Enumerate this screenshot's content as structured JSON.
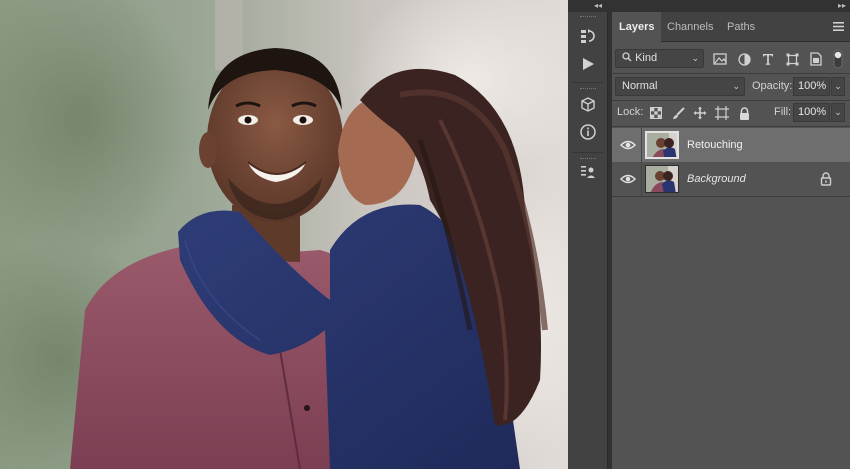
{
  "panel": {
    "tabs": [
      {
        "label": "Layers",
        "active": true
      },
      {
        "label": "Channels",
        "active": false
      },
      {
        "label": "Paths",
        "active": false
      }
    ],
    "filter": {
      "kind_label": "Kind",
      "icons": [
        "image-filter-icon",
        "adjustment-filter-icon",
        "type-filter-icon",
        "shape-filter-icon",
        "smart-object-filter-icon",
        "filter-toggle-icon"
      ]
    },
    "blend_mode": "Normal",
    "opacity_label": "Opacity:",
    "opacity_value": "100%",
    "lock_label": "Lock:",
    "lock_icons": [
      "lock-transparent-icon",
      "lock-image-icon",
      "lock-position-icon",
      "lock-artboard-icon",
      "lock-all-icon"
    ],
    "fill_label": "Fill:",
    "fill_value": "100%",
    "layers": [
      {
        "name": "Retouching",
        "visible": true,
        "selected": true,
        "locked": false
      },
      {
        "name": "Background",
        "visible": true,
        "selected": false,
        "locked": true
      }
    ]
  },
  "dock": {
    "icons": [
      "history-icon",
      "actions-play-icon",
      "3d-cube-icon",
      "info-icon",
      "properties-icon"
    ]
  },
  "theme": {
    "panel_bg": "#535353",
    "dock_bg": "#424242",
    "selected_layer": "#6e6e6e"
  }
}
